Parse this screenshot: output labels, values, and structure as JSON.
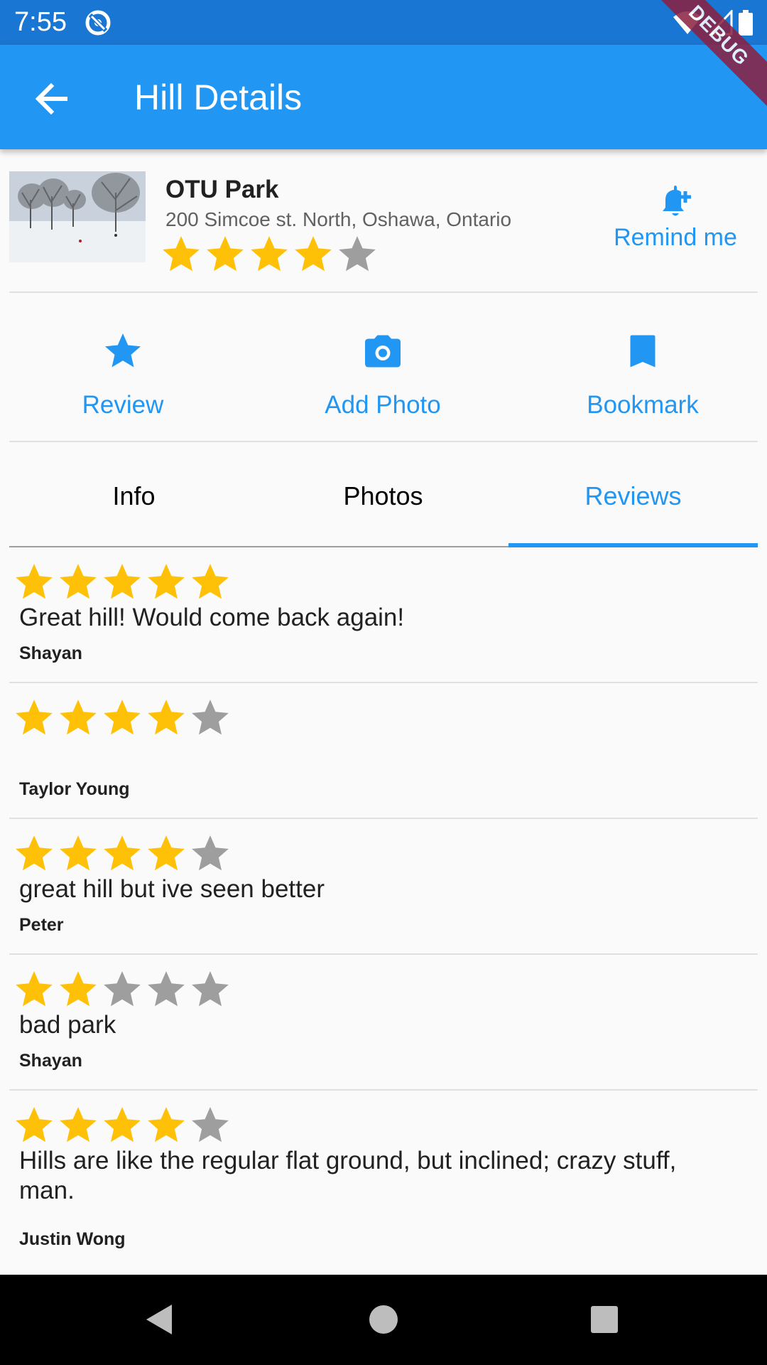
{
  "status": {
    "time": "7:55"
  },
  "debug_banner": "DEBUG",
  "appbar": {
    "title": "Hill Details"
  },
  "hill": {
    "name": "OTU Park",
    "address": "200 Simcoe st. North, Oshawa, Ontario",
    "rating": 4,
    "remind_label": "Remind me"
  },
  "actions": [
    {
      "label": "Review",
      "icon": "star-icon"
    },
    {
      "label": "Add Photo",
      "icon": "camera-icon"
    },
    {
      "label": "Bookmark",
      "icon": "bookmark-icon"
    }
  ],
  "tabs": [
    {
      "label": "Info",
      "active": false
    },
    {
      "label": "Photos",
      "active": false
    },
    {
      "label": "Reviews",
      "active": true
    }
  ],
  "reviews": [
    {
      "rating": 5,
      "text": "Great hill! Would come back again!",
      "author": "Shayan"
    },
    {
      "rating": 4,
      "text": "",
      "author": "Taylor Young"
    },
    {
      "rating": 4,
      "text": "great hill but ive seen better",
      "author": "Peter"
    },
    {
      "rating": 2,
      "text": "bad park",
      "author": "Shayan"
    },
    {
      "rating": 4,
      "text": "Hills are like the regular flat ground, but inclined; crazy stuff, man.",
      "author": "Justin Wong"
    }
  ],
  "colors": {
    "primary": "#2196f3",
    "status_bar": "#1976d2",
    "star_filled": "#ffc107",
    "star_empty": "#9e9e9e"
  }
}
